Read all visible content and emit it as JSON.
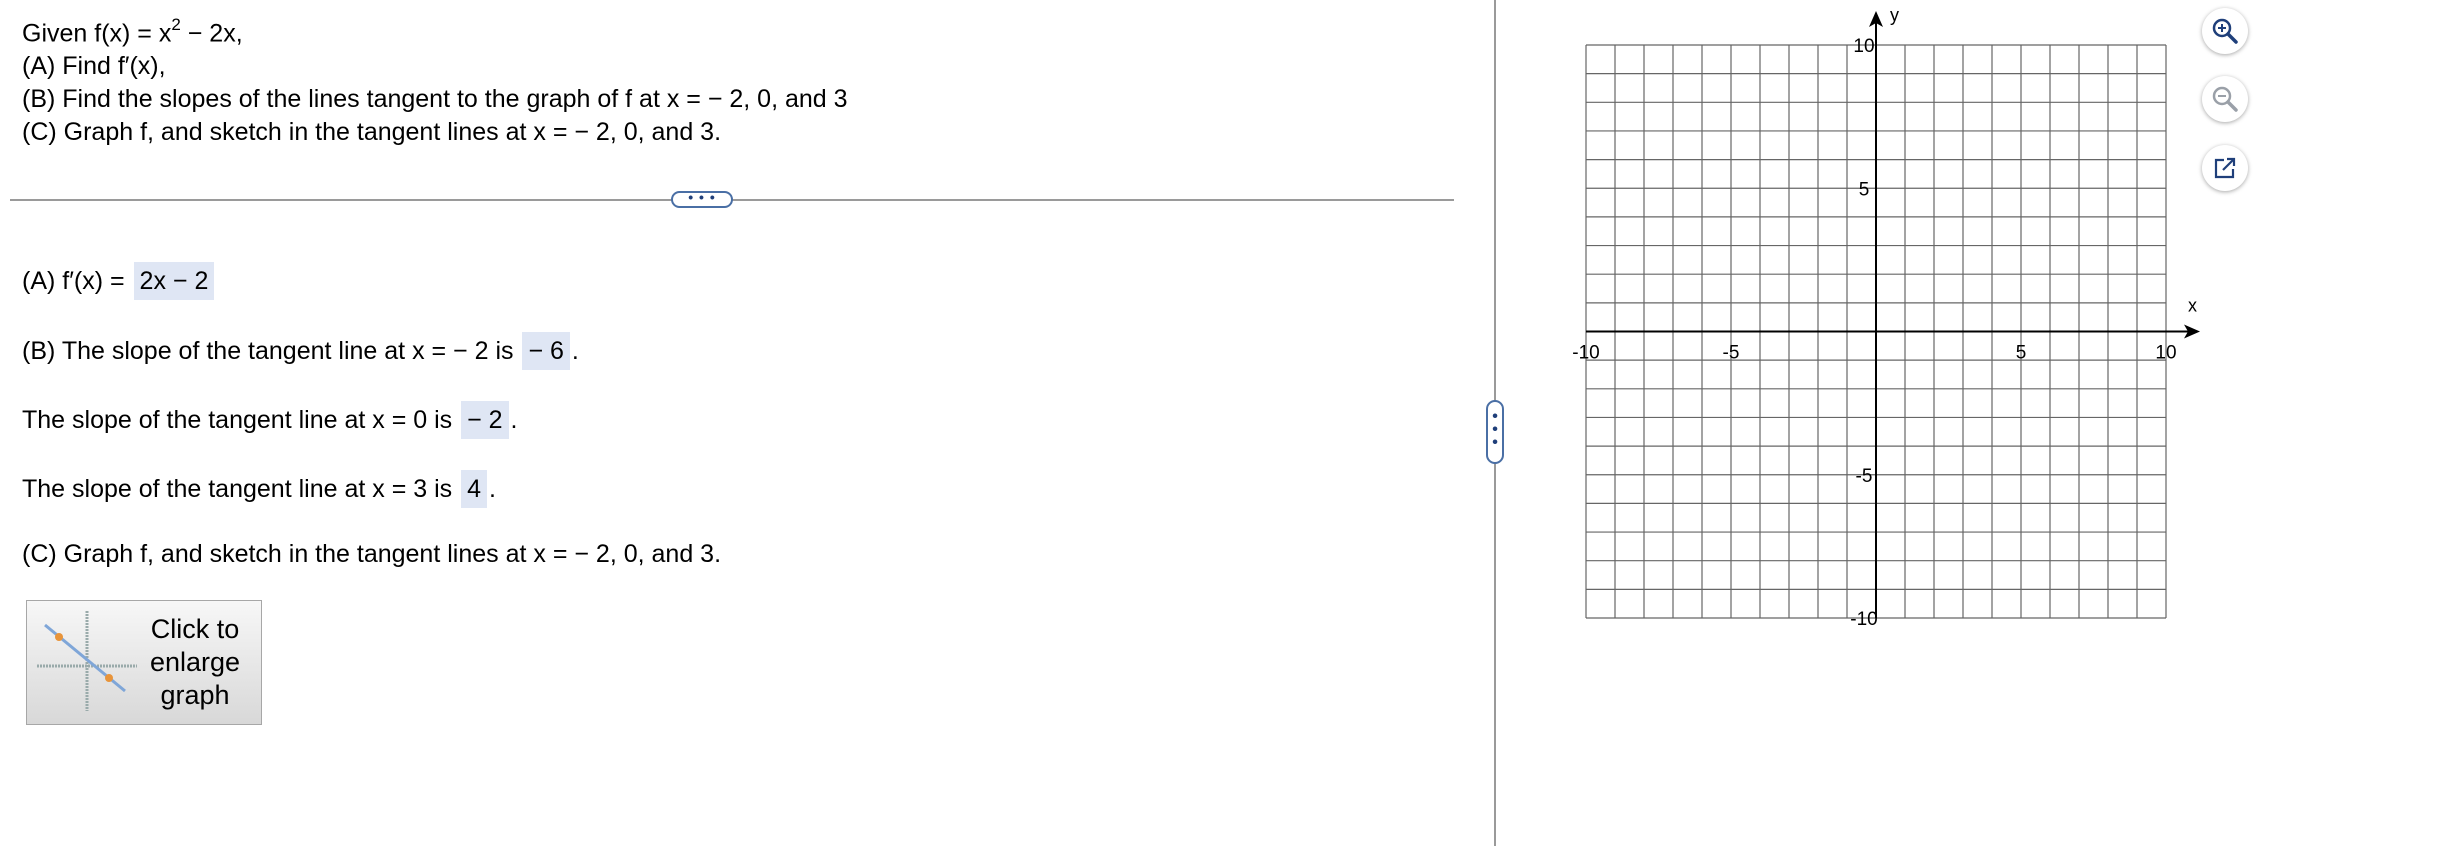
{
  "problem": {
    "given_prefix": "Given f(x) = x",
    "given_exponent": "2",
    "given_suffix": " − 2x,",
    "part_a": "(A)  Find f′(x),",
    "part_b": "(B)  Find the slopes of the lines tangent to the graph of f at x = − 2, 0, and 3",
    "part_c": "(C)  Graph f, and sketch in the tangent lines at x = − 2, 0, and 3."
  },
  "answers": {
    "a_label": "(A)  f′(x) = ",
    "a_value": "2x − 2",
    "b_label": "(B)  The slope of the tangent line at x = − 2 is ",
    "b_value": "− 6",
    "c_label": "The slope of the tangent line at x = 0 is ",
    "c_value": "− 2",
    "d_label": "The slope of the tangent line at x = 3 is ",
    "d_value": "4",
    "period": ".",
    "part_c": "(C)  Graph f, and sketch in the tangent lines at x = − 2, 0, and 3."
  },
  "enlarge_button": {
    "label": "Click to enlarge graph"
  },
  "graph": {
    "x_label": "x",
    "y_label": "y",
    "x_range": [
      -10,
      10
    ],
    "y_range": [
      -10,
      10
    ],
    "grid": true,
    "x_tick_labels": [
      "-10",
      "-5",
      "5",
      "10"
    ],
    "y_tick_labels": [
      "10",
      "5",
      "-5",
      "-10"
    ]
  },
  "tools": [
    "zoom-in-icon",
    "zoom-out-icon",
    "pop-out-icon"
  ],
  "colors": {
    "answer_box": "#dfe6f4",
    "grip_border": "#4a6fa5",
    "grid": "#666666"
  }
}
